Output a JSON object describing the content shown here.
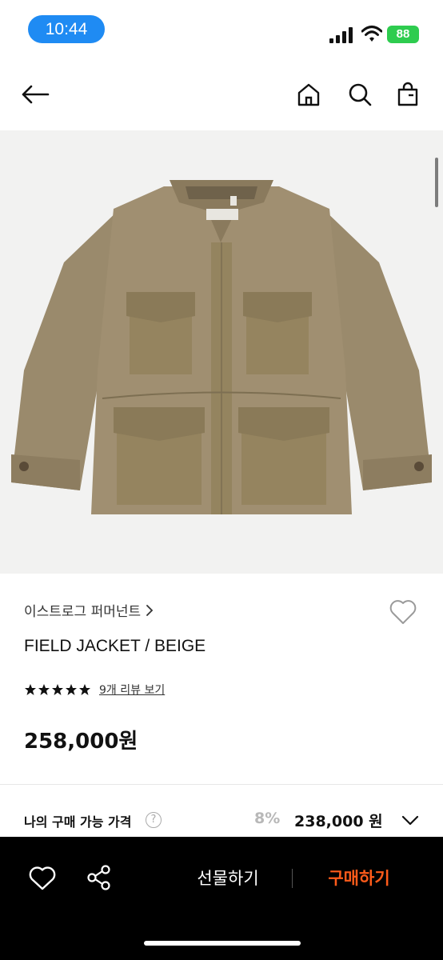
{
  "status_bar": {
    "time": "10:44",
    "battery": "88"
  },
  "product": {
    "brand": "이스트로그 퍼머넌트",
    "title": "FIELD JACKET / BEIGE",
    "review_link": "9개 리뷰 보기",
    "price": "258,000원"
  },
  "my_price": {
    "label": "나의 구매 가능 가격",
    "help": "?",
    "discount": "8%",
    "price": "238,000 원"
  },
  "actions": {
    "gift": "선물하기",
    "buy": "구매하기"
  },
  "colors": {
    "accent": "#ff5b1a",
    "time_pill": "#1f8bf3",
    "battery": "#2ecc4f",
    "jacket": "#9a8a6c"
  }
}
